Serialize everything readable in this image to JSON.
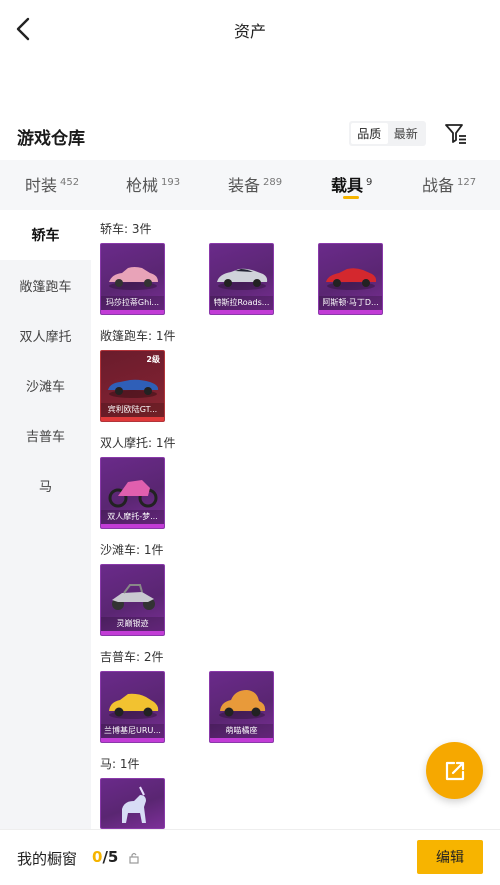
{
  "header": {
    "title": "资产"
  },
  "warehouse": {
    "title": "游戏仓库",
    "sort_options": [
      "品质",
      "最新"
    ]
  },
  "tabs": [
    {
      "label": "时装",
      "count": "452"
    },
    {
      "label": "枪械",
      "count": "193"
    },
    {
      "label": "装备",
      "count": "289"
    },
    {
      "label": "载具",
      "count": "9"
    },
    {
      "label": "战备",
      "count": "127"
    }
  ],
  "sidebar": {
    "items": [
      "轿车",
      "敞篷跑车",
      "双人摩托",
      "沙滩车",
      "吉普车",
      "马"
    ]
  },
  "groups": [
    {
      "label": "轿车: 3件",
      "items": [
        {
          "name": "玛莎拉蒂Ghi...",
          "icon": "pink-sedan-icon"
        },
        {
          "name": "特斯拉Roads...",
          "icon": "silver-roadster-icon"
        },
        {
          "name": "阿斯顿·马丁D...",
          "icon": "red-sports-car-icon"
        }
      ]
    },
    {
      "label": "敞篷跑车: 1件",
      "items": [
        {
          "name": "宾利欧陆GT...",
          "level": "2级",
          "icon": "blue-convertible-icon"
        }
      ]
    },
    {
      "label": "双人摩托: 1件",
      "items": [
        {
          "name": "双人摩托-梦...",
          "icon": "pink-motorcycle-icon"
        }
      ]
    },
    {
      "label": "沙滩车: 1件",
      "items": [
        {
          "name": "灵巅银迹",
          "icon": "buggy-icon"
        }
      ]
    },
    {
      "label": "吉普车: 2件",
      "items": [
        {
          "name": "兰博基尼URU...",
          "icon": "yellow-suv-icon"
        },
        {
          "name": "萌喵橘座",
          "icon": "orange-beetle-icon"
        }
      ]
    },
    {
      "label": "马: 1件",
      "items": [
        {
          "name": "",
          "icon": "unicorn-icon"
        }
      ]
    }
  ],
  "bottom": {
    "showcase_label": "我的橱窗",
    "showcase_used": "0",
    "showcase_total": "/5",
    "edit_label": "编辑"
  },
  "colors": {
    "accent": "#f5b400",
    "card_purple": "#6a2a8a",
    "card_red": "#7a2030",
    "sidebar_bg": "#f4f5f7"
  }
}
